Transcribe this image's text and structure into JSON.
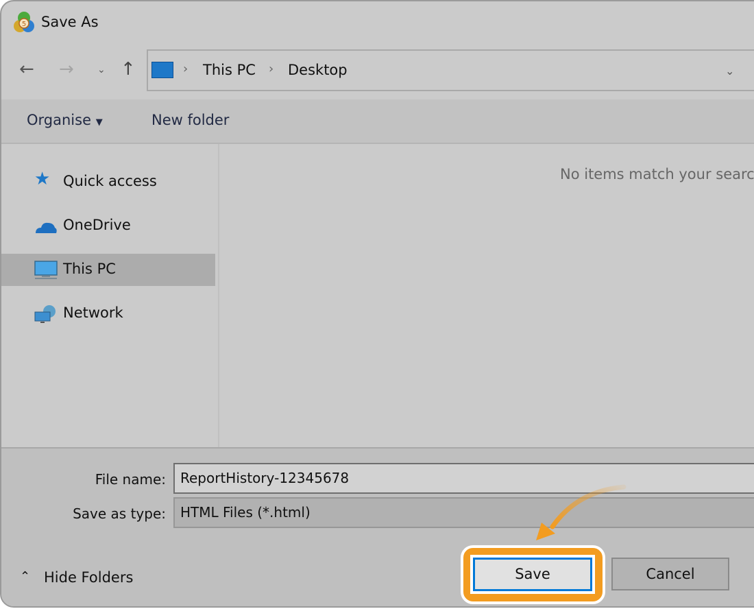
{
  "window": {
    "title": "Save As",
    "app_icon": "metatrader5-icon"
  },
  "address_bar": {
    "crumbs": [
      "This PC",
      "Desktop"
    ],
    "icon": "desktop-icon"
  },
  "toolbar": {
    "organise_label": "Organise",
    "new_folder_label": "New folder"
  },
  "sidebar": {
    "items": [
      {
        "label": "Quick access",
        "icon": "star-icon"
      },
      {
        "label": "OneDrive",
        "icon": "cloud-icon"
      },
      {
        "label": "This PC",
        "icon": "monitor-icon",
        "selected": true
      },
      {
        "label": "Network",
        "icon": "network-icon"
      }
    ]
  },
  "main": {
    "empty_message": "No items match your search."
  },
  "form": {
    "file_name_label": "File name:",
    "file_name_value": "ReportHistory-12345678",
    "save_type_label": "Save as type:",
    "save_type_value": "HTML Files (*.html)"
  },
  "footer": {
    "hide_folders_label": "Hide Folders",
    "save_label": "Save",
    "cancel_label": "Cancel"
  },
  "colors": {
    "highlight": "#f39c20",
    "focus": "#0078d7",
    "accent_icon": "#1e78c8"
  }
}
